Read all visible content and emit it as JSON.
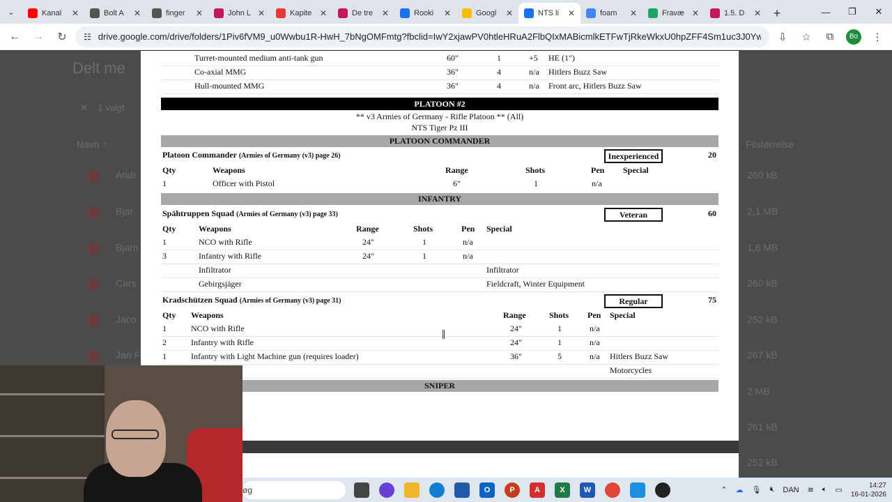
{
  "browser": {
    "tabs": [
      {
        "label": "Kanal",
        "color": "#ff0000"
      },
      {
        "label": "Bolt A",
        "color": "#555555"
      },
      {
        "label": "finger",
        "color": "#555555"
      },
      {
        "label": "John L",
        "color": "#c2185b"
      },
      {
        "label": "Kapite",
        "color": "#e53935"
      },
      {
        "label": "De tre",
        "color": "#c2185b"
      },
      {
        "label": "Rooki",
        "color": "#1a73e8"
      },
      {
        "label": "Googl",
        "color": "#fbbc04"
      },
      {
        "label": "NTS li",
        "color": "#1a73e8",
        "active": true
      },
      {
        "label": "foam",
        "color": "#4285f4"
      },
      {
        "label": "Fravæ",
        "color": "#21a366"
      },
      {
        "label": "1.5. D",
        "color": "#c2185b"
      }
    ],
    "url": "drive.google.com/drive/folders/1Piv6fVM9_u0Wwbu1R-HwH_7bNgOMFmtg?fbclid=IwY2xjawPV0htleHRuA2FlbQIxMABicmlkETFwTjRkeWkxU0hpZFF4Sm1uc3J0YwZhcHBfaWQQMjIyMDM...",
    "profile_initials": "Bo"
  },
  "drive": {
    "title": "Delt me",
    "selected": "1 valgt",
    "col_name": "Navn",
    "col_size": "Filstørrelse",
    "rows": [
      {
        "name": "Andr",
        "size": "260 kB"
      },
      {
        "name": "Bjar",
        "size": "2,1 MB"
      },
      {
        "name": "Bjarn",
        "size": "1,6 MB"
      },
      {
        "name": "Cars",
        "size": "260 kB"
      },
      {
        "name": "Jaco",
        "size": "252 kB"
      },
      {
        "name": "Jan F",
        "size": "267 kB"
      },
      {
        "name": "",
        "size": "2 MB"
      },
      {
        "name": "",
        "size": "261 kB"
      },
      {
        "name": "",
        "size": "252 kB"
      }
    ]
  },
  "document": {
    "top_rows": [
      {
        "weapon": "Turret-mounted medium anti-tank gun",
        "range": "60\"",
        "shots": "1",
        "pen": "+5",
        "special": "HE (1\")"
      },
      {
        "weapon": "Co-axial MMG",
        "range": "36\"",
        "shots": "4",
        "pen": "n/a",
        "special": "Hitlers Buzz Saw"
      },
      {
        "weapon": "Hull-mounted MMG",
        "range": "36\"",
        "shots": "4",
        "pen": "n/a",
        "special": "Front arc, Hitlers Buzz Saw"
      }
    ],
    "platoon_bar": "PLATOON #2",
    "platoon_sub1": "** v3 Armies of Germany - Rifle Platoon ** (All)",
    "platoon_sub2": "NTS Tiger Pz III",
    "commander_bar": "PLATOON COMMANDER",
    "commander": {
      "name": "Platoon Commander",
      "ref": "(Armies of Germany (v3) page 26)",
      "rating": "Inexperienced",
      "points": "20",
      "headers": {
        "qty": "Qty",
        "weapons": "Weapons",
        "range": "Range",
        "shots": "Shots",
        "pen": "Pen",
        "special": "Special"
      },
      "rows": [
        {
          "qty": "1",
          "weapon": "Officer with Pistol",
          "range": "6\"",
          "shots": "1",
          "pen": "n/a"
        }
      ]
    },
    "infantry_bar": "INFANTRY",
    "squad1": {
      "name": "Spähtruppen Squad",
      "ref": "(Armies of Germany (v3) page 33)",
      "rating": "Veteran",
      "points": "60",
      "headers": {
        "qty": "Qty",
        "weapons": "Weapons",
        "range": "Range",
        "shots": "Shots",
        "pen": "Pen",
        "special": "Special"
      },
      "rows": [
        {
          "qty": "1",
          "weapon": "NCO with Rifle",
          "range": "24\"",
          "shots": "1",
          "pen": "n/a",
          "special": ""
        },
        {
          "qty": "3",
          "weapon": "Infantry with Rifle",
          "range": "24\"",
          "shots": "1",
          "pen": "n/a",
          "special": ""
        },
        {
          "qty": "",
          "weapon": "Infiltrator",
          "range": "",
          "shots": "",
          "pen": "",
          "special": "Infiltrator"
        },
        {
          "qty": "",
          "weapon": "Gebirgsjäger",
          "range": "",
          "shots": "",
          "pen": "",
          "special": "Fieldcraft, Winter Equipment"
        }
      ]
    },
    "squad2": {
      "name": "Kradschützen Squad",
      "ref": "(Armies of Germany (v3) page 31)",
      "rating": "Regular",
      "points": "75",
      "headers": {
        "qty": "Qty",
        "weapons": "Weapons",
        "range": "Range",
        "shots": "Shots",
        "pen": "Pen",
        "special": "Special"
      },
      "rows": [
        {
          "qty": "1",
          "weapon": "NCO with Rifle",
          "range": "24\"",
          "shots": "1",
          "pen": "n/a",
          "special": ""
        },
        {
          "qty": "2",
          "weapon": "Infantry with Rifle",
          "range": "24\"",
          "shots": "1",
          "pen": "n/a",
          "special": ""
        },
        {
          "qty": "1",
          "weapon": "Infantry with Light Machine gun (requires loader)",
          "range": "36\"",
          "shots": "5",
          "pen": "n/a",
          "special": "Hitlers Buzz Saw"
        },
        {
          "qty": "",
          "weapon": "",
          "range": "",
          "shots": "",
          "pen": "",
          "special": "Motorcycles"
        }
      ]
    },
    "sniper_bar": "SNIPER"
  },
  "taskbar": {
    "search_text": "øg",
    "language": "DAN",
    "time": "14:27",
    "date": "16-01-2026"
  }
}
